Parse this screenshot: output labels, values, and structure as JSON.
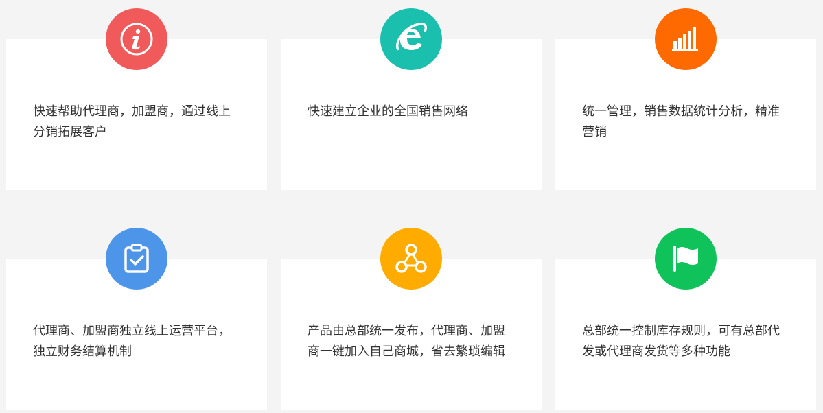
{
  "features": [
    {
      "icon": "info-icon",
      "color": "#f05a5a",
      "text": "快速帮助代理商，加盟商，通过线上分销拓展客户"
    },
    {
      "icon": "internet-explorer-icon",
      "color": "#1bbfad",
      "text": "快速建立企业的全国销售网络"
    },
    {
      "icon": "bar-chart-icon",
      "color": "#ff6a00",
      "text": "统一管理，销售数据统计分析，精准营销"
    },
    {
      "icon": "clipboard-check-icon",
      "color": "#4d95e8",
      "text": "代理商、加盟商独立线上运营平台，独立财务结算机制"
    },
    {
      "icon": "network-share-icon",
      "color": "#ffab00",
      "text": "产品由总部统一发布，代理商、加盟商一键加入自己商城，省去繁琐编辑"
    },
    {
      "icon": "flag-icon",
      "color": "#10c25a",
      "text": "总部统一控制库存规则，可有总部代发或代理商发货等多种功能"
    }
  ]
}
